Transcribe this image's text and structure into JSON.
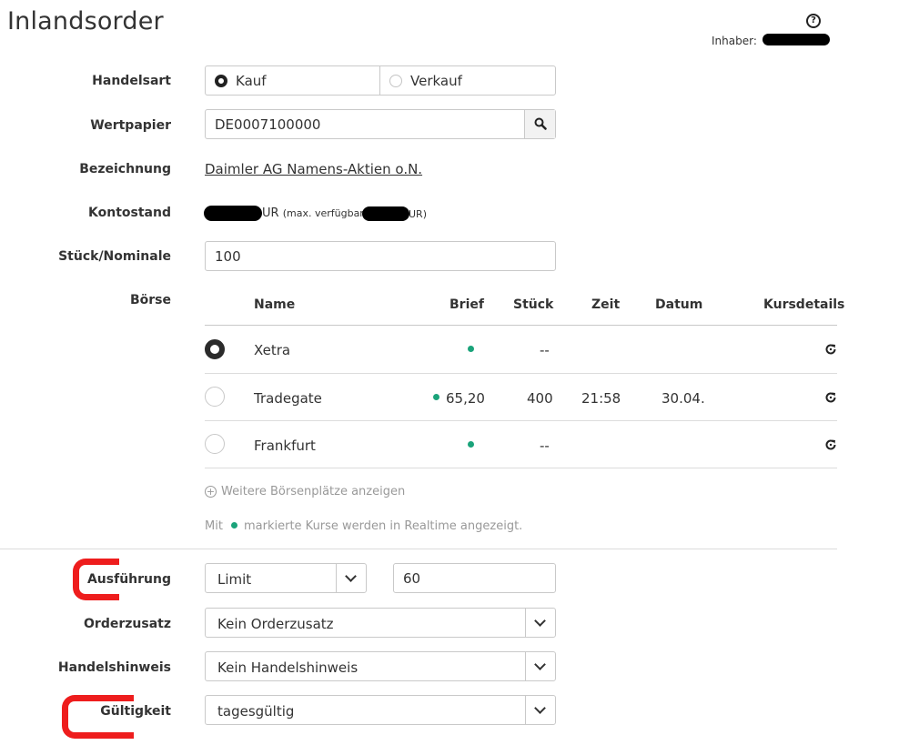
{
  "header": {
    "title": "Inlandsorder",
    "owner_label": "Inhaber:",
    "help_icon": "question-circle-icon"
  },
  "form": {
    "handelsart": {
      "label": "Handelsart",
      "options": [
        "Kauf",
        "Verkauf"
      ],
      "selected": "Kauf"
    },
    "wertpapier": {
      "label": "Wertpapier",
      "value": "DE0007100000"
    },
    "bezeichnung": {
      "label": "Bezeichnung",
      "value": "Daimler AG Namens-Aktien o.N."
    },
    "kontostand": {
      "label": "Kontostand",
      "value_suffix": "UR",
      "max_text": "(max. verfügbar",
      "max_suffix": "UR)"
    },
    "stueck": {
      "label": "Stück/Nominale",
      "value": "100"
    },
    "boerse": {
      "label": "Börse",
      "columns": [
        "Name",
        "Brief",
        "Stück",
        "Zeit",
        "Datum",
        "Kursdetails"
      ],
      "rows": [
        {
          "name": "Xetra",
          "brief": "",
          "stueck": "--",
          "zeit": "",
          "datum": "",
          "selected": true
        },
        {
          "name": "Tradegate",
          "brief": "65,20",
          "stueck": "400",
          "zeit": "21:58",
          "datum": "30.04.",
          "selected": false
        },
        {
          "name": "Frankfurt",
          "brief": "",
          "stueck": "--",
          "zeit": "",
          "datum": "",
          "selected": false
        }
      ],
      "more_link": "Weitere Börsenplätze anzeigen",
      "realtime_prefix": "Mit",
      "realtime_suffix": "markierte Kurse werden in Realtime angezeigt."
    },
    "ausfuehrung": {
      "label": "Ausführung",
      "value": "Limit",
      "limit": "60"
    },
    "orderzusatz": {
      "label": "Orderzusatz",
      "value": "Kein Orderzusatz"
    },
    "handelshinweis": {
      "label": "Handelshinweis",
      "value": "Kein Handelshinweis"
    },
    "gueltigkeit": {
      "label": "Gültigkeit",
      "value": "tagesgültig"
    }
  },
  "colors": {
    "realtime_dot": "#1aa37a",
    "annotation": "#ee1d1d"
  }
}
